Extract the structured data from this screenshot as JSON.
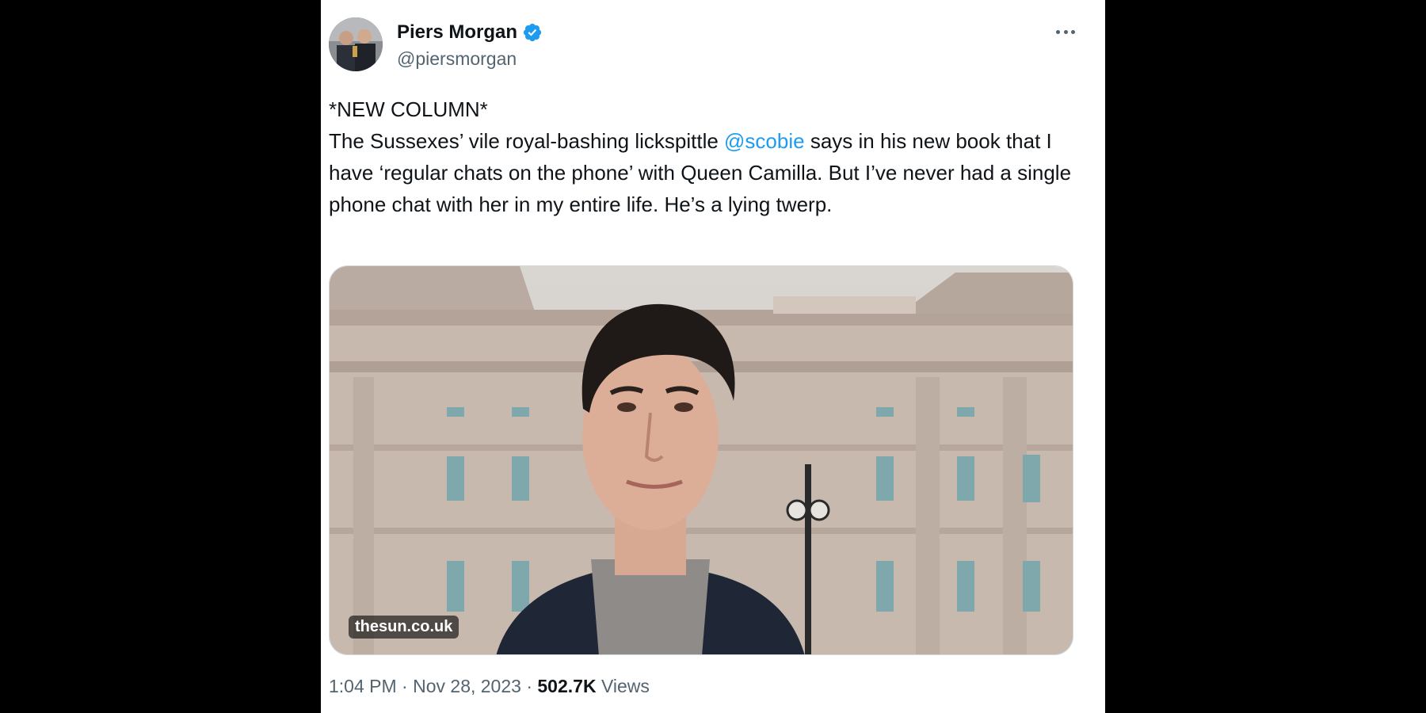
{
  "author": {
    "display_name": "Piers Morgan",
    "handle": "@piersmorgan",
    "verified": true,
    "verified_color": "#1d9bf0"
  },
  "tweet": {
    "line1": "*NEW COLUMN*",
    "text_before_mention": "The Sussexes’ vile royal-bashing lickspittle ",
    "mention": "@scobie",
    "text_after_mention": " says in his new book that I have ‘regular chats on the phone’ with Queen Camilla. But I’ve never had a single phone chat with her in my entire life. He’s a lying twerp."
  },
  "media": {
    "source_label": "thesun.co.uk"
  },
  "meta": {
    "time": "1:04 PM",
    "separator": " · ",
    "date": "Nov 28, 2023",
    "views_count": "502.7K",
    "views_label": " Views"
  },
  "icons": {
    "more": "more-horizontal-icon",
    "verified": "verified-badge-icon"
  }
}
